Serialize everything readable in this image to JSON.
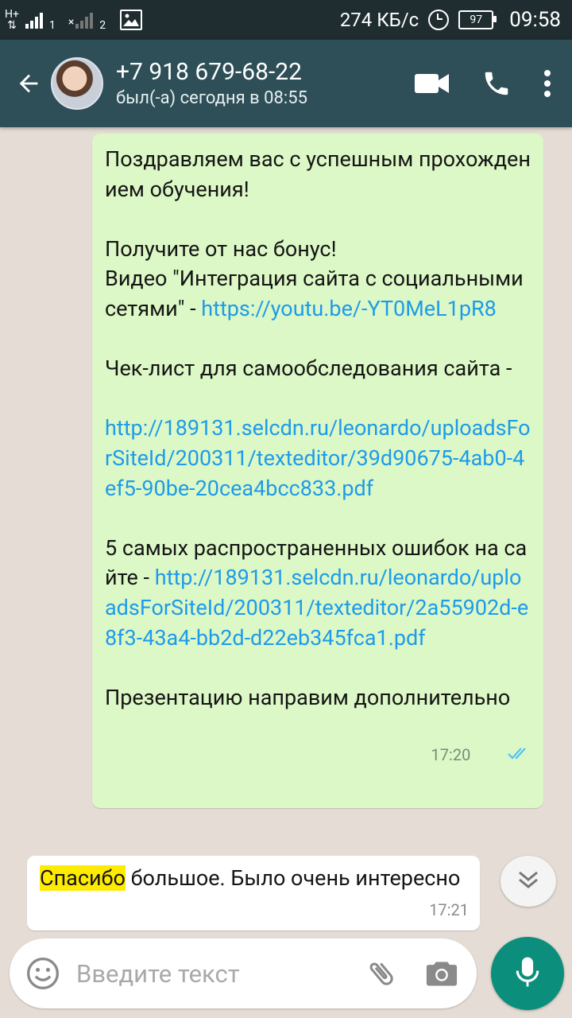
{
  "status_bar": {
    "network_type": "H+",
    "sim1": "1",
    "sim2": "2",
    "speed": "274 КБ/с",
    "battery": "97",
    "time": "09:58"
  },
  "header": {
    "contact": "+7 918 679-68-22",
    "last_seen": "был(-а) сегодня в 08:55"
  },
  "messages": {
    "outgoing": {
      "p1": "Поздравляем вас с успешным прохождением обучения!",
      "p2_line1": "Получите от нас бонус!",
      "p2_line2": "Видео \"Интеграция сайта с социальными сетями\" - ",
      "p2_link": "https://youtu.be/-YT0MeL1pR8",
      "p3": "Чек-лист для самообследования сайта -",
      "p4_link": "http://189131.selcdn.ru/leonardo/uploadsForSiteId/200311/texteditor/39d90675-4ab0-4ef5-90be-20cea4bcc833.pdf",
      "p5_text": "5 самых распространенных ошибок на сайте - ",
      "p5_link": "http://189131.selcdn.ru/leonardo/uploadsForSiteId/200311/texteditor/2a55902d-e8f3-43a4-bb2d-d22eb345fca1.pdf",
      "p6": "Презентацию направим дополнительно",
      "time": "17:20"
    },
    "incoming": {
      "highlight": "Спасибо",
      "text": " большое. Было очень интересно",
      "time": "17:21"
    }
  },
  "input": {
    "placeholder": "Введите текст"
  },
  "colors": {
    "header": "#2e4f58",
    "outgoing_bubble": "#dcf8c6",
    "link": "#1e9be9",
    "mic_button": "#0b8f7c",
    "read_ticks": "#4fc3f7"
  }
}
